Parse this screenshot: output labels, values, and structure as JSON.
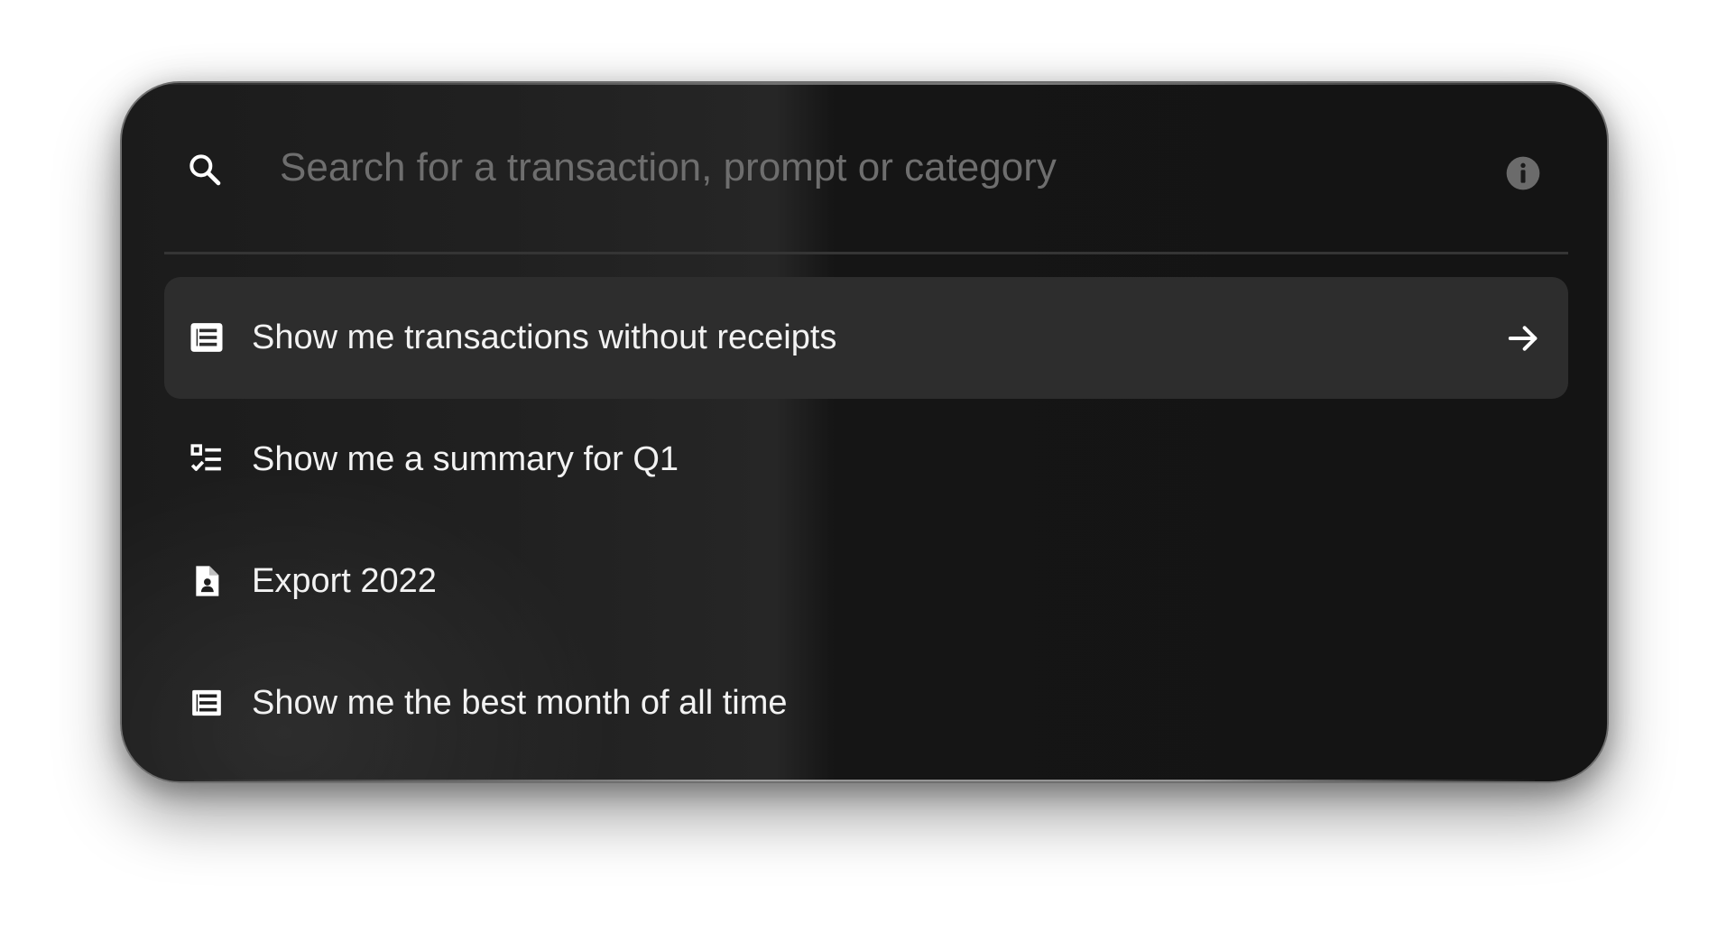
{
  "search": {
    "placeholder": "Search for a transaction, prompt or category",
    "value": "",
    "icon": "search-icon",
    "info_icon": "info-icon"
  },
  "suggestions": [
    {
      "label": "Show me transactions without receipts",
      "icon": "table-list-icon",
      "active": true,
      "trailing_icon": "arrow-right-icon"
    },
    {
      "label": "Show me a summary for Q1",
      "icon": "checklist-icon",
      "active": false
    },
    {
      "label": "Export 2022",
      "icon": "contact-file-icon",
      "active": false
    },
    {
      "label": "Show me the best month of all time",
      "icon": "table-list-icon",
      "active": false
    }
  ],
  "colors": {
    "panel": "#161616",
    "active_row": "#2d2d2d",
    "text": "#f2f2f2",
    "placeholder": "#6e6e6e",
    "icon": "#ffffff",
    "info_icon_bg": "#6b6b6b"
  }
}
